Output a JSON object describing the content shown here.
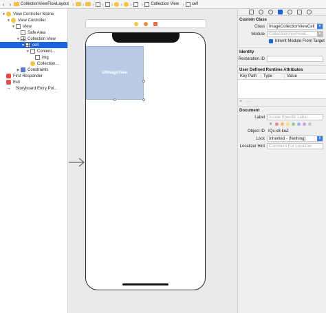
{
  "jumpbar": {
    "nav_back": "‹",
    "nav_forward": "›",
    "crumbs": [
      "CollectionViewFlowLayout",
      "Collection View",
      "cell"
    ]
  },
  "outline": {
    "items": [
      {
        "label": "View Controller Scene",
        "disclosure": "▼"
      },
      {
        "label": "View Controller",
        "disclosure": "▼"
      },
      {
        "label": "View",
        "disclosure": "▼"
      },
      {
        "label": "Safe Area",
        "disclosure": ""
      },
      {
        "label": "Collection View",
        "disclosure": "▼"
      },
      {
        "label": "cell",
        "disclosure": "▼"
      },
      {
        "label": "Content...",
        "disclosure": "▼"
      },
      {
        "label": "img",
        "disclosure": ""
      },
      {
        "label": "Collection...",
        "disclosure": ""
      },
      {
        "label": "Constraints",
        "disclosure": "▶"
      },
      {
        "label": "First Responder",
        "disclosure": ""
      },
      {
        "label": "Exit",
        "disclosure": ""
      },
      {
        "label": "Storyboard Entry Poi...",
        "disclosure": ""
      }
    ]
  },
  "canvas": {
    "cell_label": "UIImageView"
  },
  "inspector": {
    "custom_class": {
      "title": "Custom Class",
      "class_label": "Class",
      "class_value": "ImageCollectionViewCell",
      "module_label": "Module",
      "module_placeholder": "CollectionViewFlowL...",
      "inherit_label": "Inherit Module From Target"
    },
    "identity": {
      "title": "Identity",
      "restoration_label": "Restoration ID"
    },
    "runtime": {
      "title": "User Defined Runtime Attributes",
      "col_key": "Key Path",
      "col_type": "Type",
      "col_value": "Value",
      "add": "+",
      "remove": "—"
    },
    "document": {
      "title": "Document",
      "label_label": "Label",
      "label_placeholder": "Xcode Specific Label",
      "object_id_label": "Object ID",
      "object_id_value": "IQs-s8-kuZ",
      "lock_label": "Lock",
      "lock_value": "Inherited - (Nothing)",
      "localizer_label": "Localizer Hint",
      "localizer_placeholder": "Comment For Localizer",
      "swatch_colors": [
        "#f08c8c",
        "#f5b96a",
        "#f5e07a",
        "#8ed08e",
        "#8fb8f0",
        "#c9a4e6",
        "#c8c8c8"
      ]
    }
  }
}
